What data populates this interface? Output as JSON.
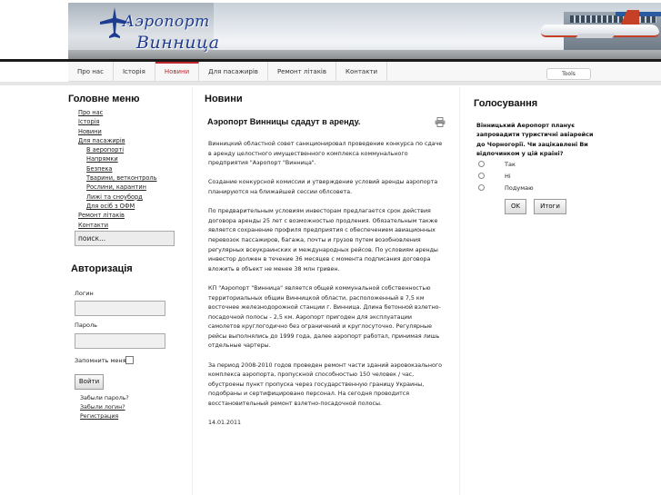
{
  "header": {
    "logo_line1": "Аэропорт",
    "logo_line2": "Винница"
  },
  "nav": {
    "items": [
      "Про нас",
      "Історія",
      "Новини",
      "Для пасажирів",
      "Ремонт літаків",
      "Контакти"
    ],
    "active": "Новини",
    "tools_label": "Tools",
    "accent_color": "#c0272d"
  },
  "sidebar": {
    "menu_title": "Головне меню",
    "menu_items": [
      {
        "label": "Про нас",
        "sub": false
      },
      {
        "label": "Історія",
        "sub": false
      },
      {
        "label": "Новини",
        "sub": false
      },
      {
        "label": "Для пасажирів",
        "sub": false
      },
      {
        "label": "В аеропорті",
        "sub": true
      },
      {
        "label": "Напрямки",
        "sub": true
      },
      {
        "label": "Безпека",
        "sub": true
      },
      {
        "label": "Тварини, ветконтроль",
        "sub": true
      },
      {
        "label": "Рослини, карантин",
        "sub": true
      },
      {
        "label": "Лижі та сноуборд",
        "sub": true
      },
      {
        "label": "Для осіб з ОФМ",
        "sub": true
      },
      {
        "label": "Ремонт літаків",
        "sub": false
      },
      {
        "label": "Контакти",
        "sub": false
      }
    ],
    "search_value": "поиск..."
  },
  "auth": {
    "title": "Авторизація",
    "login_label": "Логин",
    "password_label": "Пароль",
    "remember_label": "Запомнить меня",
    "login_button": "Войти",
    "forgot_password": "Забыли пароль?",
    "forgot_login": "Забыли логин?",
    "register": "Регистрация"
  },
  "main": {
    "section_title": "Новини",
    "article_title": "Аэропорт Винницы сдадут в аренду.",
    "paragraphs": [
      "Винницкий областной совет санкционировал проведение конкурса по сдаче в аренду целостного имущественного комплекса коммунального предприятия \"Аэропорт \"Винница\".",
      "Создание конкурсной комиссии и утверждение условий аренды аэропорта планируются на ближайшей сессии облсовета.",
      "По предварительным условиям инвесторам предлагается срок действия договора аренды 25 лет с возможностью продления. Обязательным также является сохранение профиля предприятия с обеспечением авиационных перевозок пассажиров, багажа, почты и грузов путем возобновления регулярных всеукраинских и международных рейсов. По условиям аренды инвестор должен в течение 36 месяцев с момента подписания договора вложить в объект не менее 38 млн гривен.",
      "КП \"Аэропорт \"Винница\" является общей коммунальной собственностью территориальных общин Винницкой области, расположенный в 7,5 км восточнее железнодорожной станции г. Винница. Длина бетонной взлетно-посадочной полосы - 2,5 км. Аэропорт пригоден для эксплуатации самолетов круглогодично без ограничений и круглосуточно. Регулярные рейсы выполнялись до 1999 года, далее аэропорт работал, принимая лишь отдельные чартеры.",
      "За период 2008-2010 годов проведен ремонт части зданий аэровокзального комплекса аэропорта, пропускной способностью 150 человек / час, обустроены пункт пропуска через государственную границу Украины, подобраны и сертифицировано персонал. На сегодня проводится восстановительный ремонт взлетно-посадочной полосы."
    ],
    "date": "14.01.2011"
  },
  "poll": {
    "title": "Голосування",
    "question": "Вінницький Аеропорт планує запровадити туристичні авіарейси до Чорногорії. Чи зацікавлені Ви відпочинком у цій країні?",
    "options": [
      "Так",
      "Ні",
      "Подумаю"
    ],
    "ok_button": "OK",
    "results_button": "Итоги"
  }
}
